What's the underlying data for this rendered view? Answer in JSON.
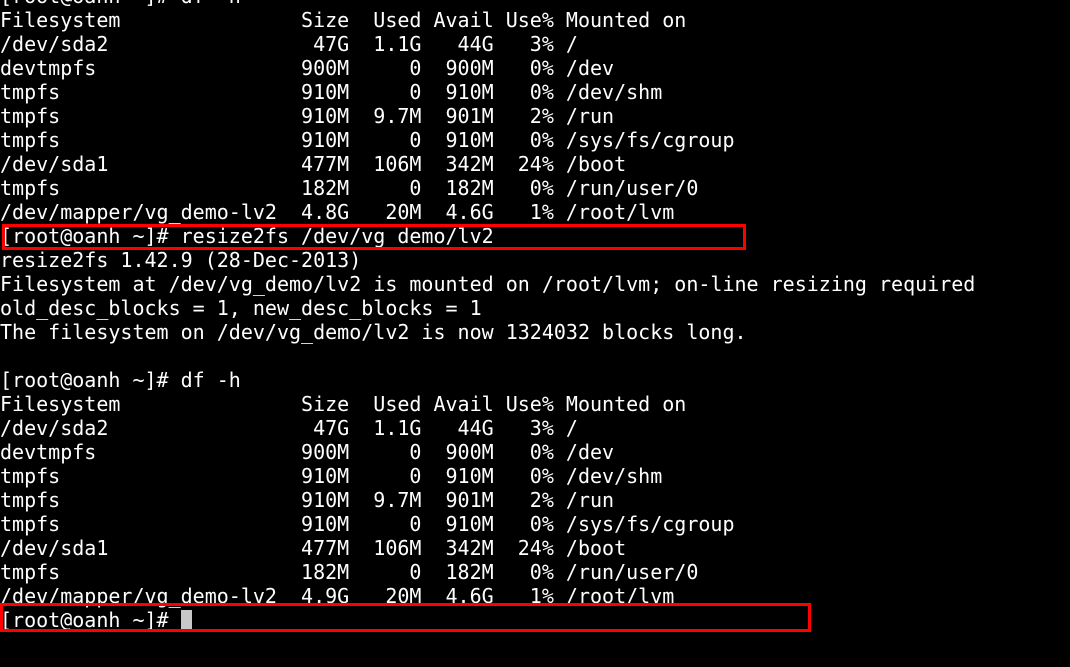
{
  "terminal": {
    "lines": [
      "[root@oanh ~]# df -h",
      "Filesystem               Size  Used Avail Use% Mounted on",
      "/dev/sda2                 47G  1.1G   44G   3% /",
      "devtmpfs                 900M     0  900M   0% /dev",
      "tmpfs                    910M     0  910M   0% /dev/shm",
      "tmpfs                    910M  9.7M  901M   2% /run",
      "tmpfs                    910M     0  910M   0% /sys/fs/cgroup",
      "/dev/sda1                477M  106M  342M  24% /boot",
      "tmpfs                    182M     0  182M   0% /run/user/0",
      "/dev/mapper/vg_demo-lv2  4.8G   20M  4.6G   1% /root/lvm",
      "[root@oanh ~]# resize2fs /dev/vg_demo/lv2",
      "resize2fs 1.42.9 (28-Dec-2013)",
      "Filesystem at /dev/vg_demo/lv2 is mounted on /root/lvm; on-line resizing required",
      "old_desc_blocks = 1, new_desc_blocks = 1",
      "The filesystem on /dev/vg_demo/lv2 is now 1324032 blocks long.",
      "",
      "[root@oanh ~]# df -h",
      "Filesystem               Size  Used Avail Use% Mounted on",
      "/dev/sda2                 47G  1.1G   44G   3% /",
      "devtmpfs                 900M     0  900M   0% /dev",
      "tmpfs                    910M     0  910M   0% /dev/shm",
      "tmpfs                    910M  9.7M  901M   2% /run",
      "tmpfs                    910M     0  910M   0% /sys/fs/cgroup",
      "/dev/sda1                477M  106M  342M  24% /boot",
      "tmpfs                    182M     0  182M   0% /run/user/0",
      "/dev/mapper/vg_demo-lv2  4.9G   20M  4.6G   1% /root/lvm"
    ],
    "prompt": "[root@oanh ~]# "
  },
  "colors": {
    "background": "#000000",
    "text": "#ffffff",
    "highlight_border": "#ff0000"
  }
}
